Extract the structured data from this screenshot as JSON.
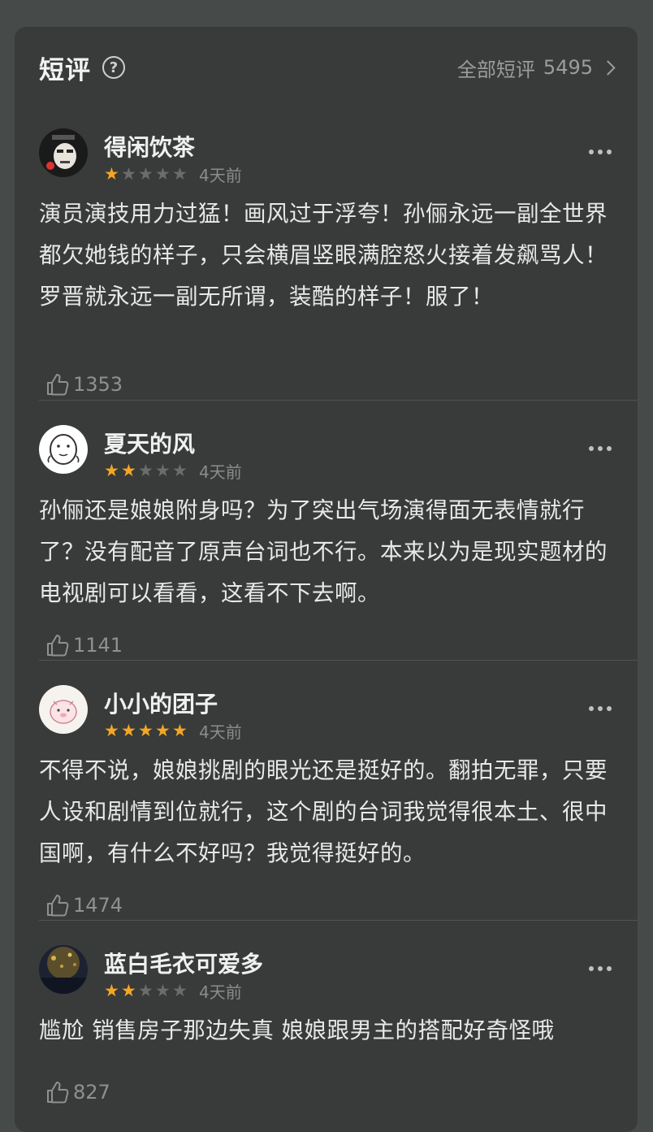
{
  "header": {
    "title": "短评",
    "help_icon": "question-circle-icon",
    "all_label": "全部短评",
    "all_count": "5495"
  },
  "colors": {
    "star_on": "#f5a623",
    "star_off": "#6a6d6c",
    "card_bg": "#383b3a"
  },
  "reviews": [
    {
      "name": "得闲饮茶",
      "rating": 1,
      "time": "4天前",
      "text": "演员演技用力过猛！画风过于浮夸！孙俪永远一副全世界都欠她钱的样子，只会横眉竖眼满腔怒火接着发飙骂人！罗晋就永远一副无所谓，装酷的样子！服了！",
      "likes": "1353"
    },
    {
      "name": "夏天的风",
      "rating": 2,
      "time": "4天前",
      "text": "孙俪还是娘娘附身吗？为了突出气场演得面无表情就行了？没有配音了原声台词也不行。本来以为是现实题材的电视剧可以看看，这看不下去啊。",
      "likes": "1141"
    },
    {
      "name": "小小的团子",
      "rating": 5,
      "time": "4天前",
      "text": "不得不说，娘娘挑剧的眼光还是挺好的。翻拍无罪，只要人设和剧情到位就行，这个剧的台词我觉得很本土、很中国啊，有什么不好吗？我觉得挺好的。",
      "likes": "1474"
    },
    {
      "name": "蓝白毛衣可爱多",
      "rating": 2,
      "time": "4天前",
      "text": "尴尬 销售房子那边失真 娘娘跟男主的搭配好奇怪哦",
      "likes": "827"
    }
  ]
}
